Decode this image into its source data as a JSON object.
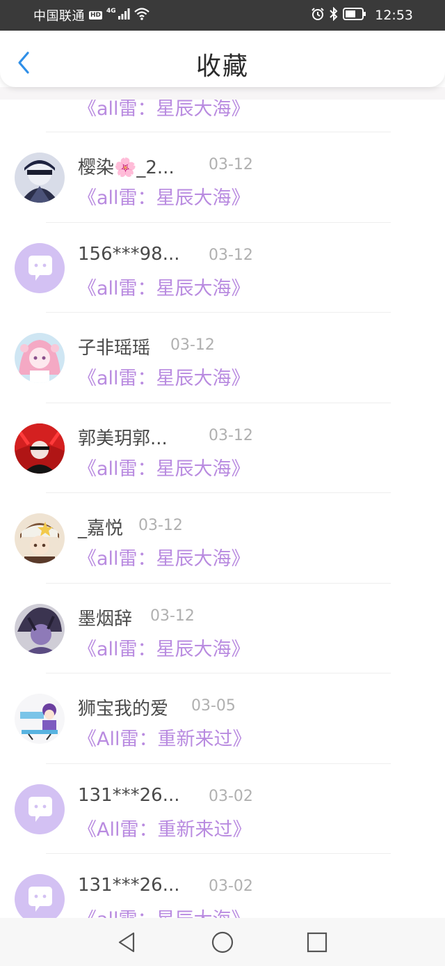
{
  "status_bar": {
    "carrier": "中国联通",
    "hd": "HD",
    "network": "4G",
    "time": "12:53"
  },
  "header": {
    "title": "收藏"
  },
  "list": {
    "partial_top_work": "《all雷：星辰大海》",
    "items": [
      {
        "name": "樱染🌸_2...",
        "date": "03-12",
        "work": "《all雷：星辰大海》",
        "avatar": "avatar-anime-masked"
      },
      {
        "name": "156***98...",
        "date": "03-12",
        "work": "《all雷：星辰大海》",
        "avatar": "avatar-default-chat"
      },
      {
        "name": "子非瑶瑶",
        "date": "03-12",
        "work": "《all雷：星辰大海》",
        "avatar": "avatar-pink-hair"
      },
      {
        "name": "郭美玥郭...",
        "date": "03-12",
        "work": "《all雷：星辰大海》",
        "avatar": "avatar-red-hair"
      },
      {
        "name": "_嘉悦",
        "date": "03-12",
        "work": "《all雷：星辰大海》",
        "avatar": "avatar-star-cap"
      },
      {
        "name": "墨烟辞",
        "date": "03-12",
        "work": "《all雷：星辰大海》",
        "avatar": "avatar-purple-dark"
      },
      {
        "name": "狮宝我的爱",
        "date": "03-05",
        "work": "《All雷：重新来过》",
        "avatar": "avatar-chibi"
      },
      {
        "name": "131***26...",
        "date": "03-02",
        "work": "《All雷：重新来过》",
        "avatar": "avatar-default-chat"
      },
      {
        "name": "131***26...",
        "date": "03-02",
        "work": "《all雷：星辰大海》",
        "avatar": "avatar-default-chat"
      }
    ]
  },
  "colors": {
    "accent_link": "#b98be0",
    "back_arrow": "#2f8fe8",
    "default_avatar_bg": "#d3c1f3"
  }
}
